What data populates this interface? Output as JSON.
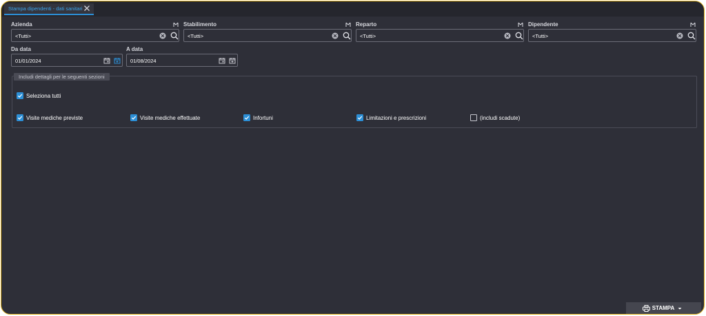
{
  "tab": {
    "title": "Stampa dipendenti - dati sanitari"
  },
  "filters": [
    {
      "label": "Azienda",
      "value": "<Tutti>"
    },
    {
      "label": "Stabilimento",
      "value": "<Tutti>"
    },
    {
      "label": "Reparto",
      "value": "<Tutti>"
    },
    {
      "label": "Dipendente",
      "value": "<Tutti>"
    }
  ],
  "dates": [
    {
      "label": "Da data",
      "value": "01/01/2024"
    },
    {
      "label": "A data",
      "value": "01/08/2024"
    }
  ],
  "section": {
    "legend": "Includi dettagli per le seguenti sezioni",
    "select_all": {
      "label": "Seleziona tutti",
      "checked": true
    },
    "options": [
      {
        "label": "Visite mediche previste",
        "checked": true
      },
      {
        "label": "Visite mediche effettuate",
        "checked": true
      },
      {
        "label": "Infortuni",
        "checked": true
      },
      {
        "label": "Limitazioni e prescrizioni",
        "checked": true
      },
      {
        "label": "(includi scadute)",
        "checked": false
      }
    ]
  },
  "actions": {
    "print_label": "STAMPA"
  },
  "colors": {
    "accent": "#2c8fd6",
    "frame": "#e8b923",
    "background": "#2e2f38"
  }
}
